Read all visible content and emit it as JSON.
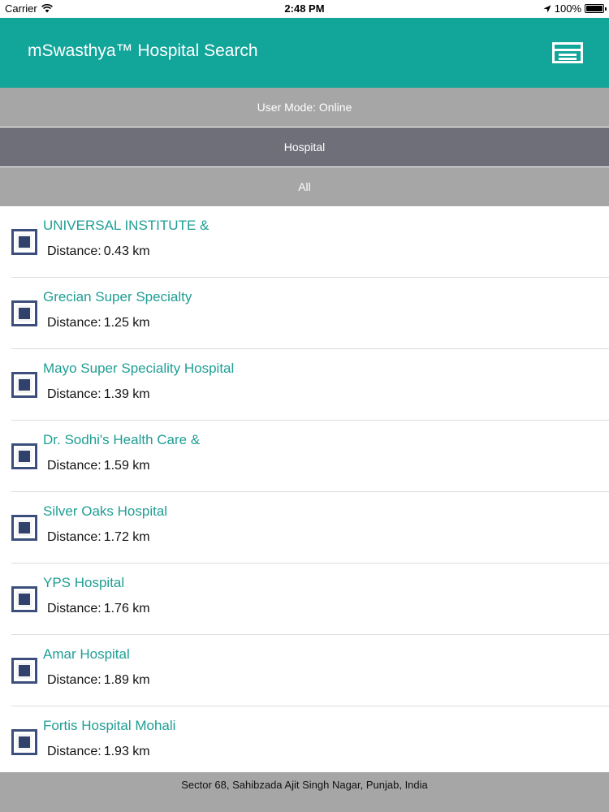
{
  "status_bar": {
    "carrier": "Carrier",
    "time": "2:48 PM",
    "battery": "100%"
  },
  "nav": {
    "title": "mSwasthya™ Hospital Search",
    "menu_icon": "menu-icon"
  },
  "bars": {
    "user_mode": "User Mode: Online",
    "category": "Hospital",
    "filter": "All"
  },
  "distance_label": "Distance:",
  "hospitals": [
    {
      "name": "UNIVERSAL INSTITUTE &",
      "distance": "0.43 km"
    },
    {
      "name": "Grecian Super Specialty",
      "distance": "1.25 km"
    },
    {
      "name": "Mayo Super Speciality Hospital",
      "distance": "1.39 km"
    },
    {
      "name": "Dr. Sodhi's Health Care &",
      "distance": "1.59 km"
    },
    {
      "name": "Silver Oaks Hospital",
      "distance": "1.72 km"
    },
    {
      "name": "YPS Hospital",
      "distance": "1.76 km"
    },
    {
      "name": "Amar Hospital",
      "distance": "1.89 km"
    },
    {
      "name": "Fortis Hospital Mohali",
      "distance": "1.93 km"
    }
  ],
  "footer": {
    "location": "Sector 68, Sahibzada Ajit Singh Nagar, Punjab, India"
  },
  "colors": {
    "nav_bg": "#12a59a",
    "hospital_name": "#1f9e94",
    "bar_light": "#a6a6a6",
    "bar_dark": "#6e6f78"
  }
}
